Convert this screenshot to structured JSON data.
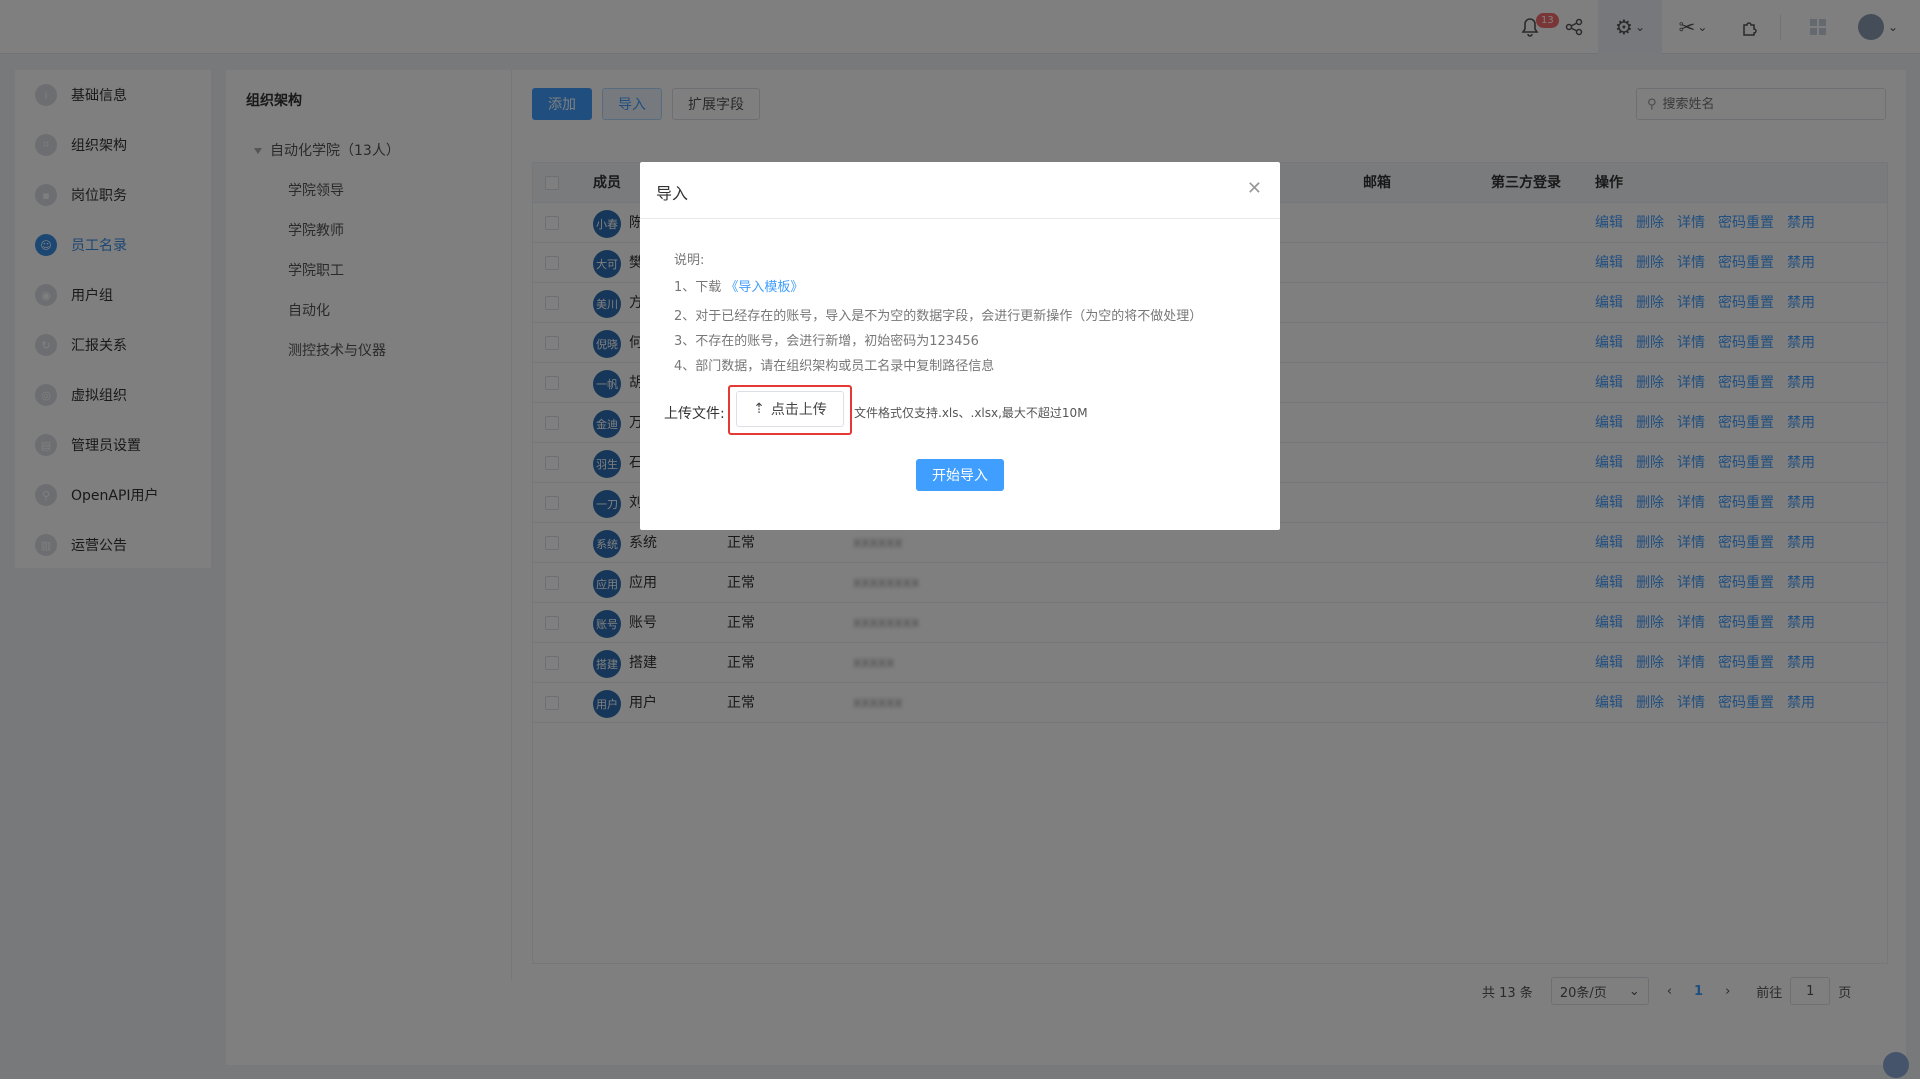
{
  "topbar": {
    "notification_count": "13",
    "avatar_text": "头像"
  },
  "sidebar": {
    "items": [
      {
        "label": "基础信息",
        "icon": "info-icon"
      },
      {
        "label": "组织架构",
        "icon": "org-icon"
      },
      {
        "label": "岗位职务",
        "icon": "position-icon"
      },
      {
        "label": "员工名录",
        "icon": "staff-icon",
        "active": true
      },
      {
        "label": "用户组",
        "icon": "group-icon"
      },
      {
        "label": "汇报关系",
        "icon": "report-icon"
      },
      {
        "label": "虚拟组织",
        "icon": "virtual-org-icon"
      },
      {
        "label": "管理员设置",
        "icon": "admin-icon"
      },
      {
        "label": "OpenAPI用户",
        "icon": "api-icon"
      },
      {
        "label": "运营公告",
        "icon": "notice-icon"
      }
    ]
  },
  "tree": {
    "title": "组织架构",
    "root": "自动化学院（13人）",
    "children": [
      "学院领导",
      "学院教师",
      "学院职工",
      "自动化",
      "测控技术与仪器"
    ]
  },
  "toolbar": {
    "add_label": "添加",
    "import_label": "导入",
    "extend_label": "扩展字段",
    "search_placeholder": "搜索姓名"
  },
  "table": {
    "headers": {
      "member": "成员",
      "email": "邮箱",
      "third_party": "第三方登录",
      "ops": "操作"
    },
    "actions": [
      "编辑",
      "删除",
      "详情",
      "密码重置",
      "禁用"
    ],
    "rows": [
      {
        "avatar": "小春",
        "name": "陈",
        "status": "",
        "account": ""
      },
      {
        "avatar": "大可",
        "name": "樊",
        "status": "",
        "account": ""
      },
      {
        "avatar": "美川",
        "name": "方",
        "status": "",
        "account": ""
      },
      {
        "avatar": "倪晓",
        "name": "何",
        "status": "",
        "account": ""
      },
      {
        "avatar": "一帆",
        "name": "胡",
        "status": "",
        "account": ""
      },
      {
        "avatar": "金迪",
        "name": "万",
        "status": "",
        "account": ""
      },
      {
        "avatar": "羽生",
        "name": "石",
        "status": "",
        "account": ""
      },
      {
        "avatar": "一刀",
        "name": "刘",
        "status": "",
        "account": ""
      },
      {
        "avatar": "系统",
        "name": "系统",
        "status": "正常",
        "account": "xxxxxx"
      },
      {
        "avatar": "应用",
        "name": "应用",
        "status": "正常",
        "account": "xxxxxxxx"
      },
      {
        "avatar": "账号",
        "name": "账号",
        "status": "正常",
        "account": "xxxxxxxx"
      },
      {
        "avatar": "搭建",
        "name": "搭建",
        "status": "正常",
        "account": "xxxxx"
      },
      {
        "avatar": "用户",
        "name": "用户",
        "status": "正常",
        "account": "xxxxxx"
      }
    ]
  },
  "pager": {
    "total": "共 13 条",
    "page_size": "20条/页",
    "current": "1",
    "goto_label": "前往",
    "goto_value": "1",
    "page_suffix": "页"
  },
  "dialog": {
    "title": "导入",
    "notes_title": "说明:",
    "note1_prefix": "1、下载",
    "note1_link": "《导入模板》",
    "note2": "2、对于已经存在的账号，导入是不为空的数据字段，会进行更新操作（为空的将不做处理）",
    "note3": "3、不存在的账号，会进行新增，初始密码为123456",
    "note4": "4、部门数据，请在组织架构或员工名录中复制路径信息",
    "upload_label": "上传文件:",
    "upload_button": "点击上传",
    "upload_hint": "文件格式仅支持.xls、.xlsx,最大不超过10M",
    "start_button": "开始导入"
  }
}
